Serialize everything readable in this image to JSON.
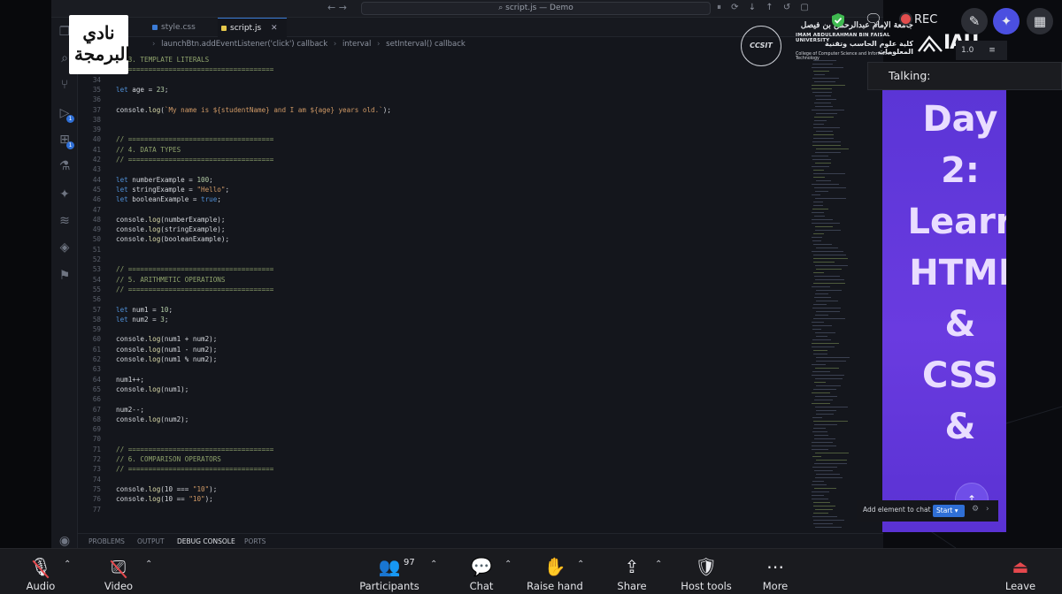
{
  "vscode": {
    "search_text": "script.js — Demo",
    "tabs": [
      {
        "label": "style.css",
        "color": "#3b7bd6"
      },
      {
        "label": "script.js",
        "color": "#e5c84b"
      }
    ],
    "tab_close": "✕",
    "breadcrumb": [
      "launchBtn.addEventListener('click') callback",
      "interval",
      "setInterval() callback"
    ],
    "panel_tabs": [
      "PROBLEMS",
      "OUTPUT",
      "DEBUG CONSOLE",
      "PORTS"
    ],
    "lines": [
      {
        "n": "32",
        "t": "// 3. TEMPLATE LITERALS",
        "k": "comment"
      },
      {
        "n": "33",
        "t": "// ====================================",
        "k": "comment"
      },
      {
        "n": "34",
        "t": "",
        "k": "plain"
      },
      {
        "n": "35",
        "t": "let age = 23;",
        "k": "plain"
      },
      {
        "n": "36",
        "t": "",
        "k": "plain"
      },
      {
        "n": "37",
        "t": "console.log(`My name is ${studentName} and I am ${age} years old.`);",
        "k": "str"
      },
      {
        "n": "38",
        "t": "",
        "k": "plain"
      },
      {
        "n": "39",
        "t": "",
        "k": "plain"
      },
      {
        "n": "40",
        "t": "// ====================================",
        "k": "comment"
      },
      {
        "n": "41",
        "t": "// 4. DATA TYPES",
        "k": "comment"
      },
      {
        "n": "42",
        "t": "// ====================================",
        "k": "comment"
      },
      {
        "n": "43",
        "t": "",
        "k": "plain"
      },
      {
        "n": "44",
        "t": "let numberExample = 100;",
        "k": "plain"
      },
      {
        "n": "45",
        "t": "let stringExample = \"Hello\";",
        "k": "plain"
      },
      {
        "n": "46",
        "t": "let booleanExample = true;",
        "k": "plain"
      },
      {
        "n": "47",
        "t": "",
        "k": "plain"
      },
      {
        "n": "48",
        "t": "console.log(numberExample);",
        "k": "plain"
      },
      {
        "n": "49",
        "t": "console.log(stringExample);",
        "k": "plain"
      },
      {
        "n": "50",
        "t": "console.log(booleanExample);",
        "k": "plain"
      },
      {
        "n": "51",
        "t": "",
        "k": "plain"
      },
      {
        "n": "52",
        "t": "",
        "k": "plain"
      },
      {
        "n": "53",
        "t": "// ====================================",
        "k": "comment"
      },
      {
        "n": "54",
        "t": "// 5. ARITHMETIC OPERATIONS",
        "k": "comment"
      },
      {
        "n": "55",
        "t": "// ====================================",
        "k": "comment"
      },
      {
        "n": "56",
        "t": "",
        "k": "plain"
      },
      {
        "n": "57",
        "t": "let num1 = 10;",
        "k": "plain"
      },
      {
        "n": "58",
        "t": "let num2 = 3;",
        "k": "plain"
      },
      {
        "n": "59",
        "t": "",
        "k": "plain"
      },
      {
        "n": "60",
        "t": "console.log(num1 + num2);",
        "k": "plain"
      },
      {
        "n": "61",
        "t": "console.log(num1 - num2);",
        "k": "plain"
      },
      {
        "n": "62",
        "t": "console.log(num1 % num2);",
        "k": "plain"
      },
      {
        "n": "63",
        "t": "",
        "k": "plain"
      },
      {
        "n": "64",
        "t": "num1++;",
        "k": "plain"
      },
      {
        "n": "65",
        "t": "console.log(num1);",
        "k": "plain"
      },
      {
        "n": "66",
        "t": "",
        "k": "plain"
      },
      {
        "n": "67",
        "t": "num2--;",
        "k": "plain"
      },
      {
        "n": "68",
        "t": "console.log(num2);",
        "k": "plain"
      },
      {
        "n": "69",
        "t": "",
        "k": "plain"
      },
      {
        "n": "70",
        "t": "",
        "k": "plain"
      },
      {
        "n": "71",
        "t": "// ====================================",
        "k": "comment"
      },
      {
        "n": "72",
        "t": "// 6. COMPARISON OPERATORS",
        "k": "comment"
      },
      {
        "n": "73",
        "t": "// ====================================",
        "k": "comment"
      },
      {
        "n": "74",
        "t": "",
        "k": "plain"
      },
      {
        "n": "75",
        "t": "console.log(10 === \"10\");",
        "k": "plain"
      },
      {
        "n": "76",
        "t": "console.log(10 == \"10\");",
        "k": "plain"
      },
      {
        "n": "77",
        "t": "",
        "k": "plain"
      }
    ]
  },
  "branding": {
    "left_logo_text": "نادي البرمجة",
    "club_badge": "CCSIT",
    "university_ar": "جامعة الإمام عبدالرحمن بن فيصل",
    "university_en": "IMAM ABDULRAHMAN BIN FAISAL UNIVERSITY",
    "college_ar": "كلية علوم الحاسب وتقنية المعلومات",
    "college_en": "College of Computer Science and Information Technology",
    "iau": "IAU"
  },
  "meeting": {
    "rec_label": "REC",
    "talking_label": "Talking:",
    "view_label": "1.0",
    "slide_text": [
      "Day",
      "2:",
      "Learr",
      "HTMI",
      "&",
      "CSS",
      "&"
    ],
    "add_to_chat_label": "Add element to chat",
    "start_label": "Start",
    "participants_count": "97",
    "toolbar": {
      "audio": "Audio",
      "video": "Video",
      "participants": "Participants",
      "chat": "Chat",
      "raise_hand": "Raise hand",
      "share": "Share",
      "host_tools": "Host tools",
      "more": "More",
      "leave": "Leave"
    }
  },
  "colors": {
    "accent_blue": "#2f6fd6",
    "slide_purple": "#5b35d6",
    "rec_red": "#e24e4e",
    "muted_red": "#e5484d"
  }
}
